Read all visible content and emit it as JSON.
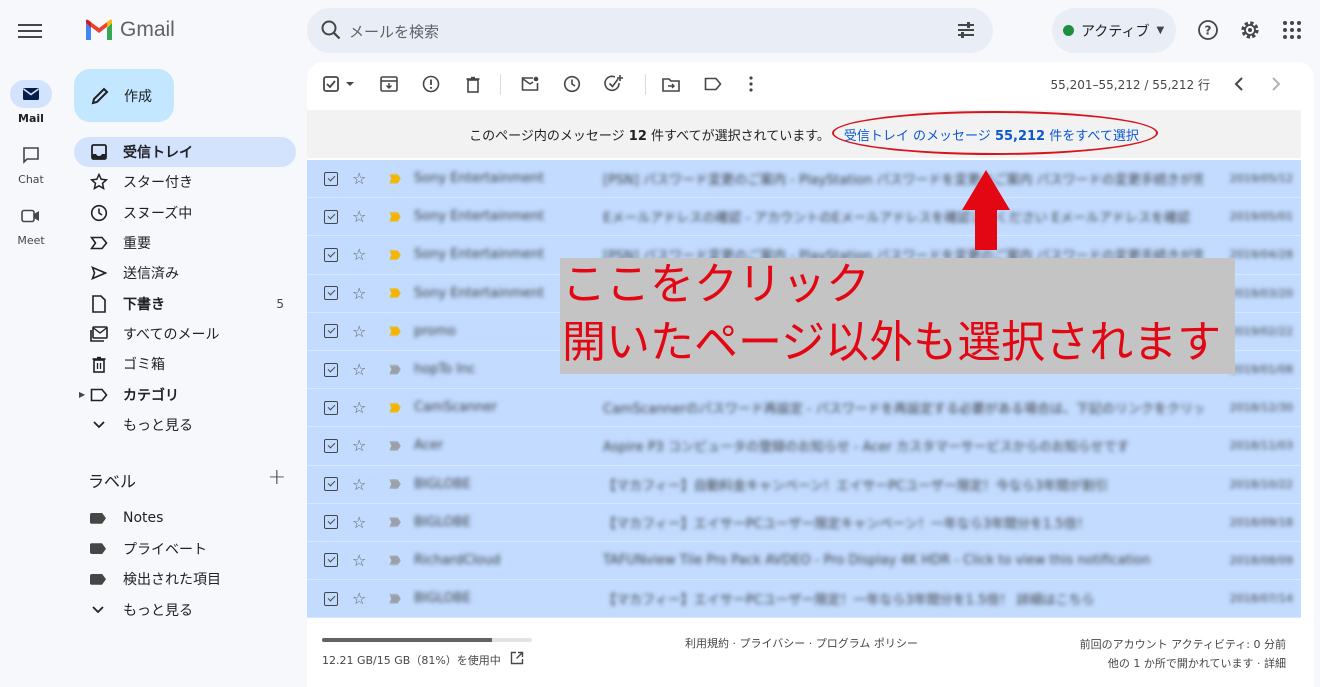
{
  "app": {
    "name": "Gmail"
  },
  "rail": [
    {
      "label": "Mail",
      "icon": "mail-icon",
      "active": true
    },
    {
      "label": "Chat",
      "icon": "chat-icon",
      "active": false
    },
    {
      "label": "Meet",
      "icon": "video-icon",
      "active": false
    }
  ],
  "search": {
    "placeholder": "メールを検索"
  },
  "status": {
    "label": "アクティブ",
    "color": "#1e8e3e"
  },
  "compose": {
    "label": "作成"
  },
  "nav": [
    {
      "label": "受信トレイ",
      "icon": "inbox-icon",
      "active": true,
      "bold": true,
      "count": ""
    },
    {
      "label": "スター付き",
      "icon": "star-icon",
      "active": false,
      "bold": false,
      "count": ""
    },
    {
      "label": "スヌーズ中",
      "icon": "clock-icon",
      "active": false,
      "bold": false,
      "count": ""
    },
    {
      "label": "重要",
      "icon": "important-icon",
      "active": false,
      "bold": false,
      "count": ""
    },
    {
      "label": "送信済み",
      "icon": "send-icon",
      "active": false,
      "bold": false,
      "count": ""
    },
    {
      "label": "下書き",
      "icon": "draft-icon",
      "active": false,
      "bold": true,
      "count": "5"
    },
    {
      "label": "すべてのメール",
      "icon": "all-mail-icon",
      "active": false,
      "bold": false,
      "count": ""
    },
    {
      "label": "ゴミ箱",
      "icon": "trash-icon",
      "active": false,
      "bold": false,
      "count": ""
    },
    {
      "label": "カテゴリ",
      "icon": "category-icon",
      "active": false,
      "bold": true,
      "count": ""
    },
    {
      "label": "もっと見る",
      "icon": "chevron-down-icon",
      "active": false,
      "bold": false,
      "count": ""
    }
  ],
  "labels": {
    "heading": "ラベル",
    "items": [
      "Notes",
      "プライベート",
      "検出された項目"
    ],
    "more": "もっと見る"
  },
  "pager": {
    "text": "55,201–55,212 / 55,212 行"
  },
  "banner": {
    "prefix": "このページ内のメッセージ",
    "count": "12",
    "suffix": "件すべてが選択されています。",
    "link_prefix": "受信トレイ のメッセージ",
    "link_count": "55,212",
    "link_suffix": "件をすべて選択"
  },
  "rows": [
    {
      "sender": "Sony Entertainment",
      "subject": "[PSN] パスワード変更のご案内 - PlayStation パスワードを変更のご案内 パスワードの変更手続きが完了しました",
      "date": "2019/05/12",
      "important": true
    },
    {
      "sender": "Sony Entertainment",
      "subject": "Eメールアドレスの確認 - アカウントのEメールアドレスを確認してください Eメールアドレスを確認",
      "date": "2019/05/01",
      "important": true
    },
    {
      "sender": "Sony Entertainment",
      "subject": "[PSN] パスワード変更のご案内 - PlayStation パスワードを変更のご案内 パスワードの変更手続きが完了",
      "date": "2019/04/28",
      "important": true
    },
    {
      "sender": "Sony Entertainment",
      "subject": "",
      "date": "2019/03/20",
      "important": true
    },
    {
      "sender": "promo",
      "subject": "",
      "date": "2019/02/22",
      "important": true
    },
    {
      "sender": "hopTo Inc",
      "subject": "",
      "date": "2019/01/08",
      "important": false
    },
    {
      "sender": "CamScanner",
      "subject": "CamScannerのパスワード再設定 - パスワードを再設定する必要がある場合は、下記のリンクをクリック",
      "date": "2018/12/30",
      "important": true
    },
    {
      "sender": "Acer",
      "subject": "Aspire P3 コンピュータの登録のお知らせ - Acer カスタマーサービスからのお知らせです",
      "date": "2018/11/03",
      "important": false
    },
    {
      "sender": "BIGLOBE",
      "subject": "【マカフィー】自動料金キャンペーン！エイサーPCユーザー限定！今なら3年間が割引",
      "date": "2018/10/22",
      "important": false
    },
    {
      "sender": "BIGLOBE",
      "subject": "【マカフィー】エイサーPCユーザー限定キャンペーン！一年なら3年間分を1.5倍！",
      "date": "2018/09/18",
      "important": false
    },
    {
      "sender": "RichardCloud",
      "subject": "TAFUNview Tile Pro Pack AVDEO - Pro Display 4K HDR - Click to view this notification",
      "date": "2018/08/09",
      "important": false
    },
    {
      "sender": "BIGLOBE",
      "subject": "【マカフィー】エイサーPCユーザー限定！一年なら3年間分を1.5倍！ 詳細はこちら",
      "date": "2018/07/14",
      "important": false
    }
  ],
  "footer": {
    "storage_text": "12.21 GB/15 GB（81%）を使用中",
    "storage_ratio": 0.81,
    "links": "利用規約 · プライバシー · プログラム ポリシー",
    "activity_line1": "前回のアカウント アクティビティ: 0 分前",
    "activity_line2": "他の 1 か所で開かれています · 詳細"
  },
  "annotation": {
    "line1": "ここをクリック",
    "line2": "開いたページ以外も選択されます",
    "color": "#e30613"
  }
}
